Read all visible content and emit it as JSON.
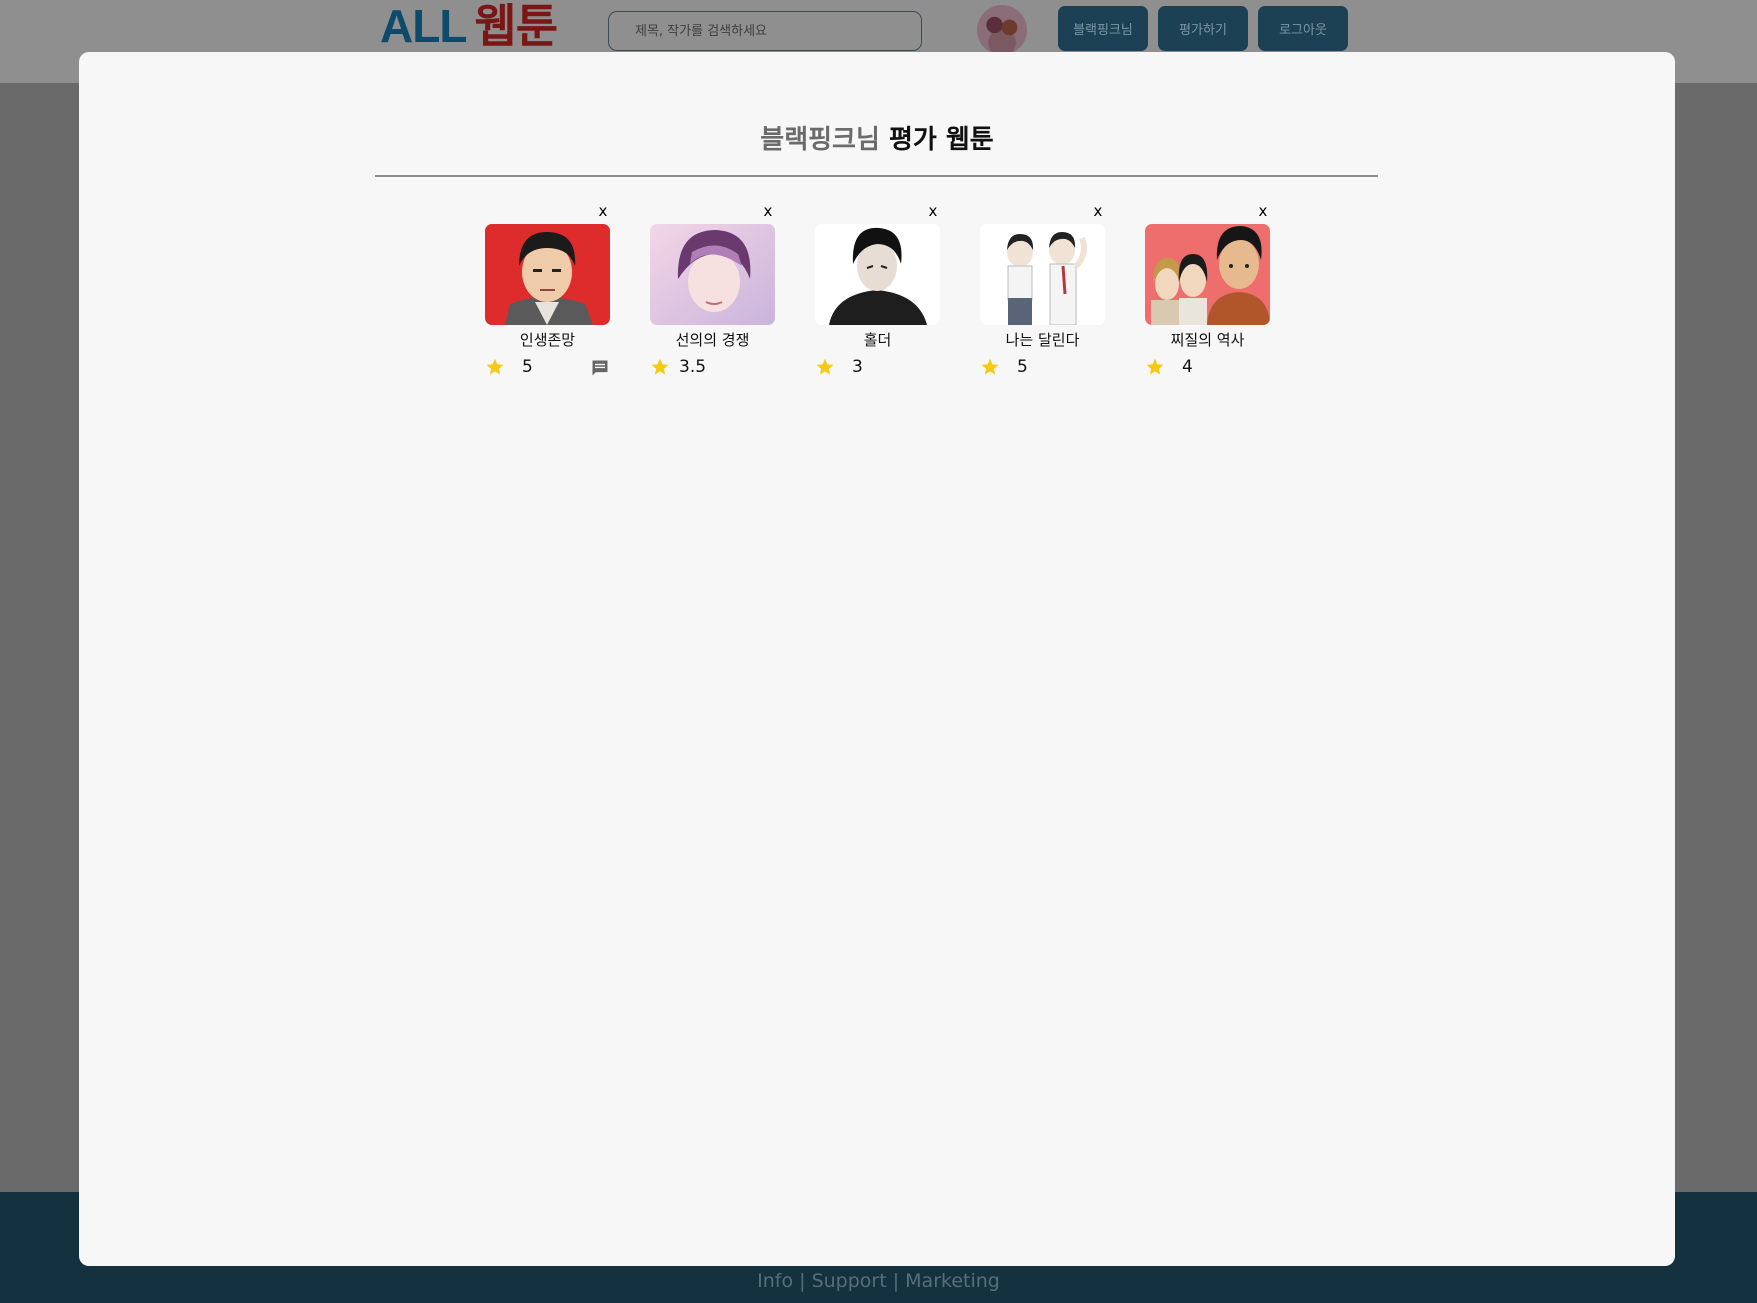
{
  "header": {
    "logo_all": "ALL",
    "logo_webtoon": "웹툰",
    "search_placeholder": "제목, 작가를 검색하세요",
    "buttons": {
      "user": "블랙핑크님",
      "rate": "평가하기",
      "logout": "로그아웃"
    }
  },
  "modal": {
    "title_user": "블랙핑크님",
    "title_rest": " 평가 웹툰",
    "close_label": "x",
    "items": [
      {
        "name": "인생존망",
        "score": "5",
        "has_comment": true
      },
      {
        "name": "선의의 경쟁",
        "score": "3.5",
        "has_comment": false
      },
      {
        "name": "홀더",
        "score": "3",
        "has_comment": false
      },
      {
        "name": "나는 달린다",
        "score": "5",
        "has_comment": false
      },
      {
        "name": "찌질의 역사",
        "score": "4",
        "has_comment": false
      }
    ]
  },
  "footer": {
    "links": "Info | Support | Marketing"
  },
  "colors": {
    "star": "#f6c915",
    "header_button_bg": "#1c4154",
    "footer_bg": "#14313f",
    "modal_bg": "#f7f7f7"
  }
}
